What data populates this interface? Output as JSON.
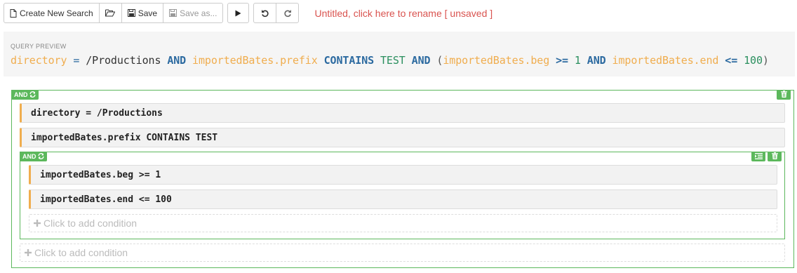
{
  "toolbar": {
    "create_new_search": "Create New Search",
    "save": "Save",
    "save_as": "Save as...",
    "rename_link": "Untitled, click here to rename [ unsaved ]"
  },
  "preview": {
    "label": "QUERY PREVIEW",
    "tokens": {
      "f1": "directory",
      "op1": "=",
      "v1": "/Productions",
      "and1": "AND",
      "f2": "importedBates.prefix",
      "kw_contains": "CONTAINS",
      "v2": "TEST",
      "and2": "AND",
      "paren_open": "(",
      "f3": "importedBates.beg",
      "op3": ">=",
      "v3": "1",
      "and3": "AND",
      "f4": "importedBates.end",
      "op4": "<=",
      "v4": "100",
      "paren_close": ")"
    }
  },
  "builder": {
    "root": {
      "operator": "AND",
      "rules": [
        "directory = /Productions",
        "importedBates.prefix CONTAINS TEST"
      ],
      "add_condition": "Click to add condition"
    },
    "subgroup": {
      "operator": "AND",
      "rules": [
        "importedBates.beg >= 1",
        "importedBates.end <= 100"
      ],
      "add_condition": "Click to add condition"
    }
  },
  "colors": {
    "group_border": "#5cb85c",
    "rule_accent": "#f0ad4e",
    "unsaved_link": "#d9534f",
    "keyword": "#2c6aa0"
  },
  "icons": [
    "file-icon",
    "folder-open-icon",
    "save-icon",
    "save-as-icon",
    "play-icon",
    "undo-icon",
    "redo-icon",
    "refresh-icon",
    "trash-icon",
    "indent-icon",
    "plus-icon"
  ]
}
